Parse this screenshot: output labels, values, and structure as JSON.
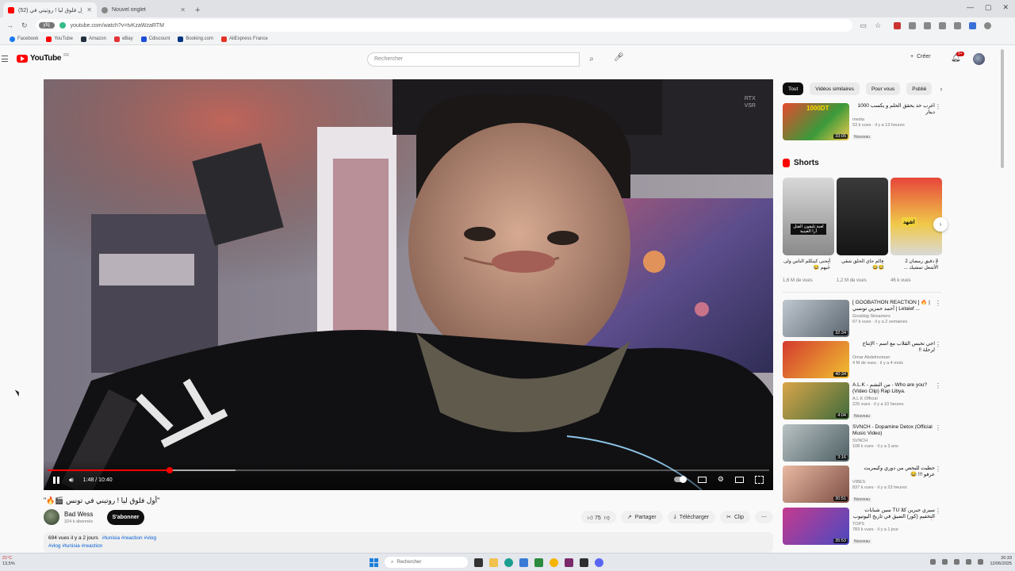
{
  "browser": {
    "tabs": [
      {
        "title": "(52) أول فلوق ليا ! روتيني في",
        "active": true,
        "color": "#ff0000"
      },
      {
        "title": "Nouvel onglet",
        "active": false,
        "color": "#888888"
      }
    ],
    "new_tab": "+",
    "url": "youtube.com/watch?v=tvKzaWzaRTM",
    "site_chip": "yfq",
    "bookmarks": [
      {
        "label": "Facebook",
        "color": "#1877f2"
      },
      {
        "label": "YouTube",
        "color": "#ff0000"
      },
      {
        "label": "Amazon",
        "color": "#232f3e"
      },
      {
        "label": "eBay",
        "color": "#e53238"
      },
      {
        "label": "Cdiscount",
        "color": "#1d4ed8"
      },
      {
        "label": "Booking.com",
        "color": "#003580"
      },
      {
        "label": "AliExpress France",
        "color": "#e43225"
      }
    ]
  },
  "header": {
    "logo_text": "YouTube",
    "logo_suffix": "FR",
    "search_placeholder": "Rechercher",
    "create_label": "Créer",
    "notif_count": "9+"
  },
  "player": {
    "current_time": "1:48",
    "duration": "10:40",
    "played_fraction": 0.169,
    "buffered_fraction": 0.26,
    "rtx_badge": [
      "RTX",
      "VSR"
    ]
  },
  "video": {
    "title": "\"أول فلوق ليا ! روتيني في تونس 🎬🔥\"",
    "channel": "Bad Wess",
    "subscribers": "324 k abonnés",
    "subscribe_label": "S'abonner",
    "likes": "75",
    "share_label": "Partager",
    "download_label": "Télécharger",
    "clip_label": "Clip",
    "views": "694 vues",
    "age": "il y a 2 jours",
    "tags": "#tunisia #reaction #vlog",
    "tags_line2": "#vlog #tunisia #reaction"
  },
  "sidebar": {
    "chips": [
      "Tout",
      "Vidéos similaires",
      "Pour vous",
      "Publié"
    ],
    "shorts_title": "Shorts",
    "top_rec": {
      "title": "أغرب حد يحقق الحلم و يكسب 1000 دينار",
      "channel": "mesta",
      "meta": "53 k vues · il y a 13 heures",
      "badge": "Nouveau",
      "duration": "33:05",
      "thumb_text": "1000DT"
    },
    "shorts": [
      {
        "caption": "أنحنى كيتكلم الناس ولى جيهم 😂",
        "views": "1,6 M de vues",
        "thumb_text": "لعبة تليفون القتل أرا العينية"
      },
      {
        "caption": "عالم جاي الحلق شقي 😂😂",
        "views": "1,2 M de vues",
        "thumb_text": ""
      },
      {
        "caption": "3 دقيق رمضان 2 الأشعل تمشيك ...",
        "views": "46 k vues",
        "thumb_text": "اشهد"
      }
    ],
    "recs": [
      {
        "title": "[ GOOBATHON REACTION ] 🔥 | أحمد حمزين تونسي | Letaief ...",
        "channel": "Goubbig Streamers",
        "meta": "67 k vues · il y a 2 semaines",
        "badge": "",
        "duration": "32:34"
      },
      {
        "title": "اجي نحبس القلاب مع اسم - الإنتاج لرحلة !!",
        "channel": "Omar Abdelmoman",
        "meta": "4 M de vues · il y a 4 mois",
        "badge": "",
        "duration": "40:34"
      },
      {
        "title": "A.L.K - من النشم - Who are you? (Video Clip) Rap Libya.",
        "channel": "A.L.K Official",
        "meta": "226 vues · il y a 10 heures",
        "badge": "Nouveau",
        "duration": "4:04"
      },
      {
        "title": "SVNCH - Dopamine Detox (Official Music Video)",
        "channel": "SVNCH",
        "meta": "108 k vues · il y a 3 ans",
        "badge": "",
        "duration": "3:16"
      },
      {
        "title": "حطيت للبحص من دوري وكيمريت عرفو !!! 😂",
        "channel": "VIBES",
        "meta": "837 k vues · il y a 23 heures",
        "badge": "Nouveau",
        "duration": "30:51"
      },
      {
        "title": "سيري جبرين كلا TU سين شبابات التخفيم (كور) الضيق في تاريخ اليوتيوب 🔥",
        "channel": "TOPS",
        "meta": "783 k vues · il y a 1 jour",
        "badge": "Nouveau",
        "duration": "35:53"
      }
    ]
  },
  "taskbar": {
    "weather": "21°C",
    "weather_sub": "13,5%",
    "search": "Rechercher",
    "time": "20:33",
    "date": "12/06/2025"
  }
}
